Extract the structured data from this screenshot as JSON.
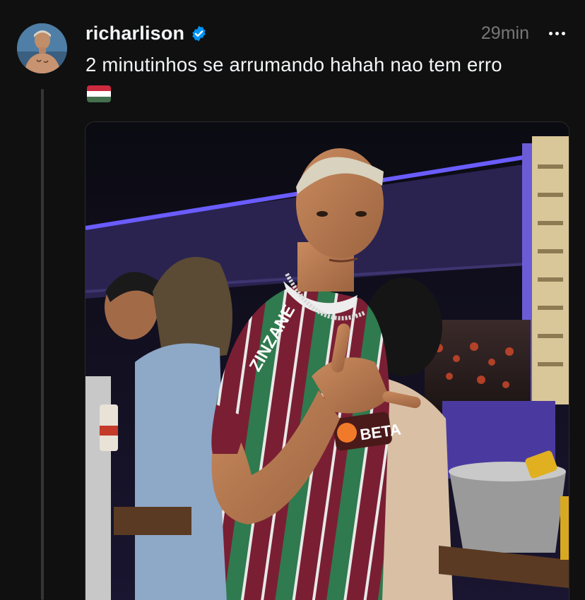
{
  "post": {
    "author": {
      "username": "richarlison",
      "verified": true,
      "avatar_icon": "profile-avatar"
    },
    "timestamp": "29min",
    "caption": "2 minutinhos se arrumando hahah nao tem erro",
    "caption_emoji": "hungarian-flag-emoji",
    "media": {
      "type": "photo",
      "jersey_sponsor_text": "ZINZANE",
      "jersey_badge_text": "BETA"
    }
  },
  "colors": {
    "background": "#101010",
    "text": "#f3f5f7",
    "muted": "#777777",
    "verified": "#0095f6",
    "flag_red": "#cd2a3e",
    "flag_white": "#ffffff",
    "flag_green": "#436f4d"
  }
}
